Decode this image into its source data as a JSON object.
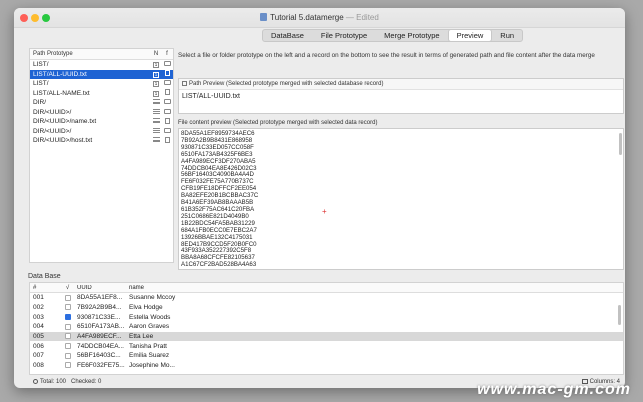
{
  "window": {
    "title": "Tutorial 5.datamerge",
    "edited": "— Edited"
  },
  "tabs": [
    "DataBase",
    "File Prototype",
    "Merge Prototype",
    "Preview",
    "Run"
  ],
  "active_tab": "Preview",
  "prototype_list": {
    "header": {
      "name": "Path Prototype",
      "n": "N",
      "f": "f"
    },
    "rows": [
      {
        "name": "LIST/",
        "n_icon": "box-icon",
        "f_icon": "folder-icon"
      },
      {
        "name": "LIST/ALL-UUID.txt",
        "n_icon": "box-icon",
        "f_icon": "file-icon",
        "selected": true
      },
      {
        "name": "LIST/",
        "n_icon": "box-icon",
        "f_icon": "folder-icon"
      },
      {
        "name": "LIST/ALL-NAME.txt",
        "n_icon": "box-icon",
        "f_icon": "file-icon"
      },
      {
        "name": "DIR/",
        "n_icon": "lines-icon",
        "f_icon": "folder-icon"
      },
      {
        "name": "DIR/<UUID>/",
        "n_icon": "lines-icon",
        "f_icon": "folder-icon"
      },
      {
        "name": "DIR/<UUID>/name.txt",
        "n_icon": "lines-icon",
        "f_icon": "file-icon"
      },
      {
        "name": "DIR/<UUID>/",
        "n_icon": "lines-icon",
        "f_icon": "folder-icon"
      },
      {
        "name": "DIR/<UUID>/host.txt",
        "n_icon": "lines-icon",
        "f_icon": "file-icon"
      }
    ]
  },
  "instruction": "Select a file or folder prototype  on the left and a record on the bottom to see the result in terms of generated path and file content after the data merge",
  "path_preview": {
    "label": "Path Preview (Selected prototype merged with selected database record)",
    "value": "LIST/ALL-UUID.txt"
  },
  "content_preview": {
    "label": "File content preview (Selected prototype merged with selected data record)",
    "lines": [
      "8DA55A1EF8959734AEC6",
      "7B92A2B9B8431E868958",
      "930871C33ED057CC058F",
      "6510FA173AB4325F6BE3",
      "A4FA989ECF3DF270ABA5",
      "74DDCB04EA8E426D02C3",
      "56BF16403C4090BA4A4D",
      "FE6F032FE75A770B737C",
      "CFB19FE18DFFCF2EE054",
      "BA82EFE20B1BCBBAC37C",
      "B41A6EF39AB8BAAAB5B",
      "61B352F75AC641C20FBA",
      "251C0686E821D4049B0",
      "1B22BDC54FA5BAB31229",
      "684A1FB0ECC0E7EBC2A7",
      "13926BBAE132C4175031",
      "8ED417B9CCD5F20B0FC0",
      "43F933A352227392C5F8",
      "BBA8A68CFCFE82105637",
      "A1C67CF2BAD528BA4A63"
    ]
  },
  "database": {
    "title": "Data Base",
    "columns": [
      "#",
      "√",
      "UUID",
      "name"
    ],
    "rows": [
      {
        "num": "001",
        "checked": false,
        "uuid": "8DA55A1EF8...",
        "name": "Susanne Mccoy"
      },
      {
        "num": "002",
        "checked": false,
        "uuid": "7B92A2B9B4...",
        "name": "Elva Hodge"
      },
      {
        "num": "003",
        "checked": true,
        "uuid": "930871C33E...",
        "name": "Estella Woods"
      },
      {
        "num": "004",
        "checked": false,
        "uuid": "6510FA173AB...",
        "name": "Aaron Graves"
      },
      {
        "num": "005",
        "checked": false,
        "uuid": "A4FA989ECF...",
        "name": "Etta Lee",
        "selected": true
      },
      {
        "num": "006",
        "checked": false,
        "uuid": "74DDCB04EA...",
        "name": "Tanisha Pratt"
      },
      {
        "num": "007",
        "checked": false,
        "uuid": "56BF16403C...",
        "name": "Emilia Suarez"
      },
      {
        "num": "008",
        "checked": false,
        "uuid": "FE6F032FE75...",
        "name": "Josephine Mo..."
      }
    ]
  },
  "status": {
    "total": "Total: 100",
    "checked": "Checked: 0",
    "columns": "Columns: 4"
  },
  "watermark": "www.mac-gm.com",
  "colors": {
    "selection": "#1e63d3",
    "checkbox_on": "#2c6fe0"
  }
}
